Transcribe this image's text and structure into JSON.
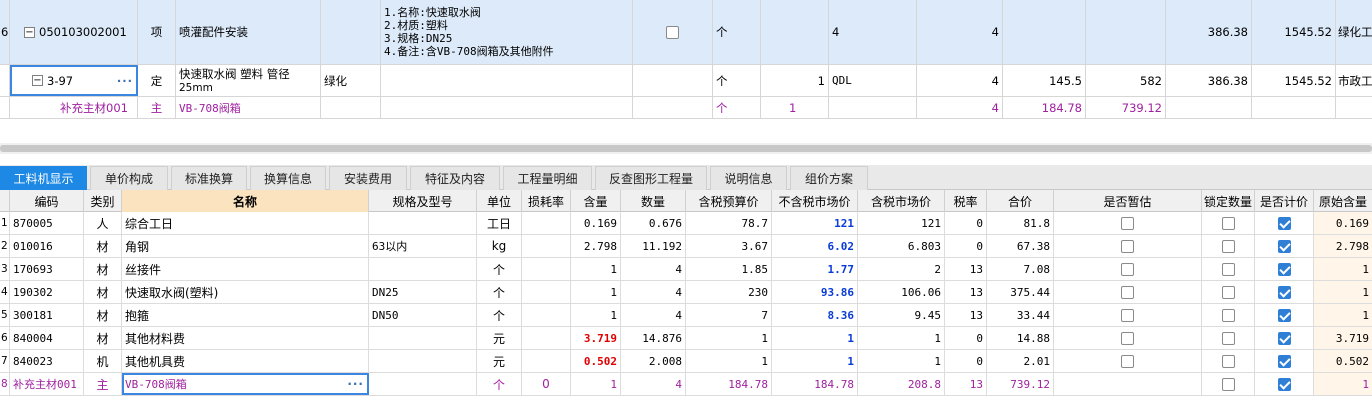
{
  "top_rows": [
    {
      "index": "6",
      "code": "050103002001",
      "tree": "−",
      "type": "项",
      "name": "喷灌配件安装",
      "spec": "",
      "features": [
        "1.名称:快速取水阀",
        "2.材质:塑料",
        "3.规格:DN25",
        "4.备注:含VB-708阀箱及其他附件"
      ],
      "checked": false,
      "unit": "个",
      "coef": "",
      "expr": "4",
      "qty": "4",
      "price1": "",
      "price2": "",
      "unit_price": "386.38",
      "total": "1545.52",
      "tail": "绿化工"
    },
    {
      "code": "3-97",
      "tree": "−",
      "type": "定",
      "name": "快速取水阀 塑料 管径",
      "name2": "25mm",
      "spec": "绿化",
      "unit": "个",
      "coef": "1",
      "expr": "QDL",
      "qty": "4",
      "price1": "145.5",
      "price2": "582",
      "unit_price": "386.38",
      "total": "1545.52",
      "tail": "市政工"
    },
    {
      "code": "补充主材001",
      "type": "主",
      "name": "VB-708阀箱",
      "unit": "个",
      "coef": "1",
      "qty": "4",
      "price1": "184.78",
      "price2": "739.12"
    }
  ],
  "tabs": [
    "工料机显示",
    "单价构成",
    "标准换算",
    "换算信息",
    "安装费用",
    "特征及内容",
    "工程量明细",
    "反查图形工程量",
    "说明信息",
    "组价方案"
  ],
  "columns": [
    "编码",
    "类别",
    "名称",
    "规格及型号",
    "单位",
    "损耗率",
    "含量",
    "数量",
    "含税预算价",
    "不含税市场价",
    "含税市场价",
    "税率",
    "合价",
    "是否暂估",
    "锁定数量",
    "是否计价",
    "原始含量"
  ],
  "rows": [
    {
      "i": "1",
      "code": "870005",
      "cat": "人",
      "name": "综合工日",
      "spec": "",
      "unit": "工日",
      "loss": "",
      "content": "0.169",
      "qty": "0.676",
      "tax_budget": "78.7",
      "market_ex": "121",
      "market_in": "121",
      "rate": "0",
      "total": "81.8",
      "est": false,
      "lock": false,
      "priced": true,
      "orig": "0.169",
      "content_red": false
    },
    {
      "i": "2",
      "code": "010016",
      "cat": "材",
      "name": "角钢",
      "spec": "63以内",
      "unit": "kg",
      "loss": "",
      "content": "2.798",
      "qty": "11.192",
      "tax_budget": "3.67",
      "market_ex": "6.02",
      "market_in": "6.803",
      "rate": "0",
      "total": "67.38",
      "est": false,
      "lock": false,
      "priced": true,
      "orig": "2.798",
      "content_red": false
    },
    {
      "i": "3",
      "code": "170693",
      "cat": "材",
      "name": "丝接件",
      "spec": "",
      "unit": "个",
      "loss": "",
      "content": "1",
      "qty": "4",
      "tax_budget": "1.85",
      "market_ex": "1.77",
      "market_in": "2",
      "rate": "13",
      "total": "7.08",
      "est": false,
      "lock": false,
      "priced": true,
      "orig": "1",
      "content_red": false
    },
    {
      "i": "4",
      "code": "190302",
      "cat": "材",
      "name": "快速取水阀(塑料)",
      "spec": "DN25",
      "unit": "个",
      "loss": "",
      "content": "1",
      "qty": "4",
      "tax_budget": "230",
      "market_ex": "93.86",
      "market_in": "106.06",
      "rate": "13",
      "total": "375.44",
      "est": false,
      "lock": false,
      "priced": true,
      "orig": "1",
      "content_red": false
    },
    {
      "i": "5",
      "code": "300181",
      "cat": "材",
      "name": "抱箍",
      "spec": "DN50",
      "unit": "个",
      "loss": "",
      "content": "1",
      "qty": "4",
      "tax_budget": "7",
      "market_ex": "8.36",
      "market_in": "9.45",
      "rate": "13",
      "total": "33.44",
      "est": false,
      "lock": false,
      "priced": true,
      "orig": "1",
      "content_red": false
    },
    {
      "i": "6",
      "code": "840004",
      "cat": "材",
      "name": "其他材料费",
      "spec": "",
      "unit": "元",
      "loss": "",
      "content": "3.719",
      "qty": "14.876",
      "tax_budget": "1",
      "market_ex": "1",
      "market_in": "1",
      "rate": "0",
      "total": "14.88",
      "est": false,
      "lock": false,
      "priced": true,
      "orig": "3.719",
      "content_red": true
    },
    {
      "i": "7",
      "code": "840023",
      "cat": "机",
      "name": "其他机具费",
      "spec": "",
      "unit": "元",
      "loss": "",
      "content": "0.502",
      "qty": "2.008",
      "tax_budget": "1",
      "market_ex": "1",
      "market_in": "1",
      "rate": "0",
      "total": "2.01",
      "est": false,
      "lock": false,
      "priced": true,
      "orig": "0.502",
      "content_red": true
    },
    {
      "i": "8",
      "code": "补充主材001",
      "cat": "主",
      "name": "VB-708阀箱",
      "spec": "",
      "unit": "个",
      "loss": "0",
      "content": "1",
      "qty": "4",
      "tax_budget": "184.78",
      "market_ex": "184.78",
      "market_in": "208.8",
      "rate": "13",
      "total": "739.12",
      "est": false,
      "lock": false,
      "priced": true,
      "orig": "1",
      "content_red": false
    }
  ],
  "ellipsis": "···",
  "colors": {
    "accent": "#1e88e5",
    "purple": "#a020a0",
    "blue_value": "#0a3bd8",
    "red_value": "#e00000",
    "selected_row": "#dceafa"
  }
}
